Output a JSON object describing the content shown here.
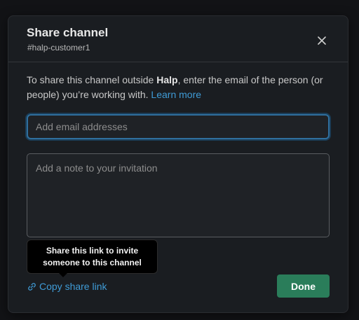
{
  "modal": {
    "title": "Share channel",
    "channel": "#halp-customer1",
    "close_icon": "close-icon"
  },
  "description": {
    "prefix": "To share this channel outside ",
    "workspace": "Halp",
    "suffix": ", enter the email of the person (or people) you’re working with. ",
    "link": "Learn more"
  },
  "email_input": {
    "placeholder": "Add email addresses"
  },
  "note_input": {
    "placeholder": "Add a note to your invitation"
  },
  "tooltip": {
    "line1": "Share this link to invite",
    "line2": "someone to this channel"
  },
  "copy_link": {
    "label": "Copy share link",
    "icon": "link-icon"
  },
  "done_button": {
    "label": "Done"
  },
  "colors": {
    "accent": "#2a7d5a",
    "link": "#3f9bd6",
    "background": "#1a1d21"
  }
}
